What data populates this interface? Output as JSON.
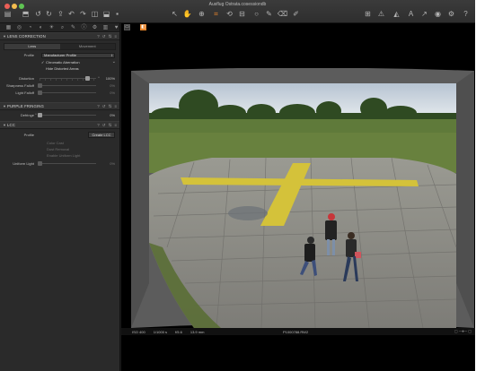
{
  "window": {
    "title": "Ausflug Ostrata.cosessiondb",
    "toolbar_left_icons": [
      "library-icon",
      "import-icon",
      "rotate-left-icon",
      "rotate-right-icon",
      "copy-adjustments-icon",
      "undo-icon",
      "reset-icon",
      "crop-icon",
      "export-icon"
    ],
    "toolbar_center_icons": [
      "select-cursor-icon",
      "pan-icon",
      "zoom-icon",
      "crop-tool-icon",
      "rotate-tool-icon",
      "keystone-icon",
      "spot-remove-icon",
      "brush-icon",
      "eraser-icon",
      "picker-icon",
      "annotate-icon"
    ],
    "toolbar_right_icons": [
      "grid-icon",
      "warning-icon",
      "exposure-warning-icon",
      "text-icon",
      "cursor-icon",
      "proof-icon",
      "settings-icon",
      "help-icon"
    ],
    "accent_color": "#e8852b"
  },
  "sidebar": {
    "tool_tabs": [
      "library-tab-icon",
      "capture-tab-icon",
      "lens-tab-icon",
      "color-tab-icon",
      "exposure-tab-icon",
      "detail-tab-icon",
      "adjust-tab-icon",
      "metadata-tab-icon",
      "output-tab-icon",
      "batch-tab-icon",
      "favorites-tab-icon"
    ],
    "lens_correction": {
      "title": "LENS CORRECTION",
      "tabs": [
        "Lens",
        "Movement"
      ],
      "profile_label": "Profile",
      "profile_value": "Manufacturer Profile",
      "option_checked": "Chromatic Aberration",
      "option_unchecked": "Hide Distorted Areas",
      "distortion_label": "Distortion",
      "distortion_value": "100%",
      "distortion_level": 0.85,
      "sharpness_label": "Sharpness Falloff",
      "sharpness_value": "0%",
      "light_label": "Light Falloff",
      "light_value": "0%"
    },
    "purple_fringing": {
      "title": "PURPLE FRINGING",
      "defringe_label": "Defringe",
      "defringe_value": "0%"
    },
    "lcc": {
      "title": "LCC",
      "profile_label": "Profile",
      "create_button": "Create LCC",
      "options": [
        "Color Cast",
        "Dust Removal",
        "Enable Uniform Light"
      ],
      "uniform_label": "Uniform Light",
      "uniform_value": "0%"
    }
  },
  "viewer": {
    "status": {
      "iso": "ISO 400",
      "shutter": "1/1000 s",
      "aperture": "f/5.6",
      "focal": "13.9 mm",
      "filename": "P1000788.RW2"
    }
  }
}
